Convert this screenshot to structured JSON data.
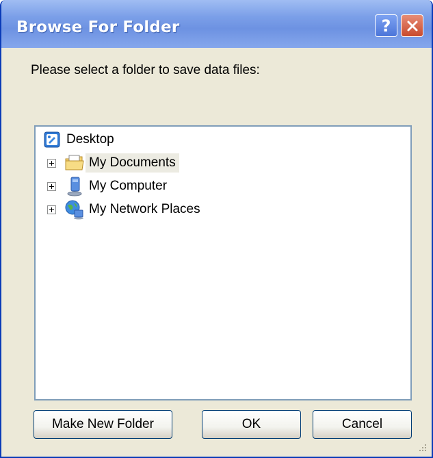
{
  "dialog": {
    "title": "Browse For Folder",
    "help_glyph": "?",
    "prompt": "Please select a folder to save data files:"
  },
  "tree": {
    "items": [
      {
        "label": "Desktop",
        "icon": "desktop-icon",
        "expandable": false,
        "selected": false
      },
      {
        "label": "My Documents",
        "icon": "my-documents-folder-icon",
        "expandable": true,
        "selected": true
      },
      {
        "label": "My Computer",
        "icon": "my-computer-icon",
        "expandable": true,
        "selected": false
      },
      {
        "label": "My Network Places",
        "icon": "network-places-icon",
        "expandable": true,
        "selected": false
      }
    ]
  },
  "buttons": {
    "make_new_folder": "Make New Folder",
    "ok": "OK",
    "cancel": "Cancel"
  },
  "colors": {
    "titlebar": "#7b9fe8",
    "window_frame": "#0a3bb8",
    "dialog_bg": "#ece9d8",
    "close_button": "#c94a2c",
    "tree_border": "#7f9db9",
    "button_border": "#003c74"
  }
}
